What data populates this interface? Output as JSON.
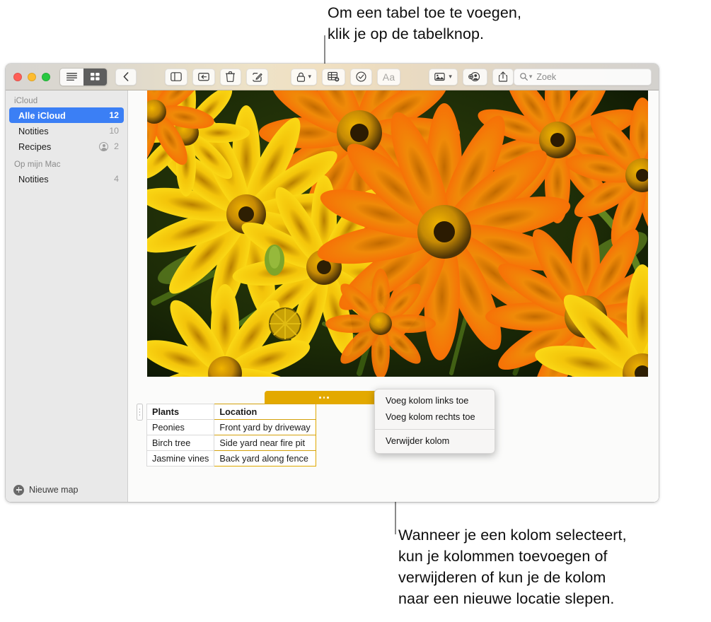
{
  "callouts": {
    "top": "Om een tabel toe te voegen,\nklik je op de tabelknop.",
    "bottom": "Wanneer je een kolom selecteert,\nkun je kolommen toevoegen of\nverwijderen of kun je de kolom\nnaar een nieuwe locatie slepen."
  },
  "window": {
    "traffic_lights": [
      "close",
      "minimize",
      "zoom"
    ],
    "colors": {
      "close": "#ff5f57",
      "minimize": "#febc2e",
      "zoom": "#28c840",
      "selection_blue": "#3b7ff5",
      "table_accent_yellow": "#e3a900"
    }
  },
  "toolbar": {
    "view_list_label": "list-view",
    "view_grid_label": "gallery-view",
    "back_label": "back",
    "sidebar_toggle_label": "toggle-sidebar",
    "folder_label": "move-to-folder",
    "delete_label": "delete-note",
    "compose_label": "new-note",
    "lock_label": "lock",
    "table_label": "table",
    "checklist_label": "checklist",
    "format_label": "Aa",
    "media_label": "media",
    "share_people_label": "add-people",
    "share_label": "share"
  },
  "search": {
    "placeholder": "Zoek"
  },
  "sidebar": {
    "groups": [
      {
        "title": "iCloud",
        "items": [
          {
            "label": "Alle iCloud",
            "count": "12",
            "selected": true,
            "shared": false
          },
          {
            "label": "Notities",
            "count": "10",
            "selected": false,
            "shared": false
          },
          {
            "label": "Recipes",
            "count": "2",
            "selected": false,
            "shared": true
          }
        ]
      },
      {
        "title": "Op mijn Mac",
        "items": [
          {
            "label": "Notities",
            "count": "4",
            "selected": false,
            "shared": false
          }
        ]
      }
    ],
    "new_folder_label": "Nieuwe map"
  },
  "note": {
    "photo_alt": "orange-and-yellow-daisy-flowers-photo",
    "table": {
      "headers": [
        "Plants",
        "Location"
      ],
      "rows": [
        [
          "Peonies",
          "Front yard by driveway"
        ],
        [
          "Birch tree",
          "Side yard near fire pit"
        ],
        [
          "Jasmine vines",
          "Back yard along fence"
        ]
      ],
      "selected_column_index": 1
    }
  },
  "context_menu": {
    "items": [
      "Voeg kolom links toe",
      "Voeg kolom rechts toe"
    ],
    "destructive": "Verwijder kolom"
  }
}
